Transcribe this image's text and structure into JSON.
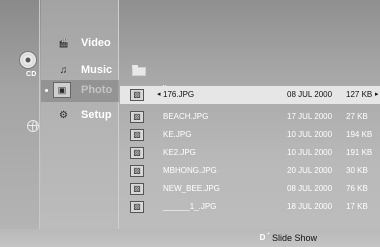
{
  "source": {
    "disc_icon": "cd-icon",
    "disc_label": "CD",
    "network_icon": "globe-icon"
  },
  "menu": {
    "items": [
      {
        "label": "Video",
        "icon": "video-icon",
        "active": false
      },
      {
        "label": "Music",
        "icon": "music-icon",
        "active": false
      },
      {
        "label": "Photo",
        "icon": "photo-icon",
        "active": true
      },
      {
        "label": "Setup",
        "icon": "setup-icon",
        "active": false
      }
    ]
  },
  "files": {
    "parent_folder_label": "..",
    "rows": [
      {
        "name": "176.JPG",
        "date": "08 JUL 2000",
        "size": "127 KB",
        "selected": true
      },
      {
        "name": "BEACH.JPG",
        "date": "17 JUL 2000",
        "size": "27 KB",
        "selected": false
      },
      {
        "name": "KE.JPG",
        "date": "10 JUL 2000",
        "size": "194 KB",
        "selected": false
      },
      {
        "name": "KE2.JPG",
        "date": "10 JUL 2000",
        "size": "191 KB",
        "selected": false
      },
      {
        "name": "MBHONG.JPG",
        "date": "20 JUL 2000",
        "size": "30 KB",
        "selected": false
      },
      {
        "name": "NEW_BEE.JPG",
        "date": "08 JUL 2000",
        "size": "76 KB",
        "selected": false
      },
      {
        "name": "______1_.JPG",
        "date": "18 JUL 2000",
        "size": "17 KB",
        "selected": false
      }
    ]
  },
  "footer": {
    "key_label": "D",
    "key_superscript": "+",
    "action_label": "Slide Show"
  },
  "colors": {
    "background": "#a7a7a7",
    "selected_row": "#e6e6e6",
    "text_light": "#ffffff",
    "text_dark": "#111111"
  }
}
